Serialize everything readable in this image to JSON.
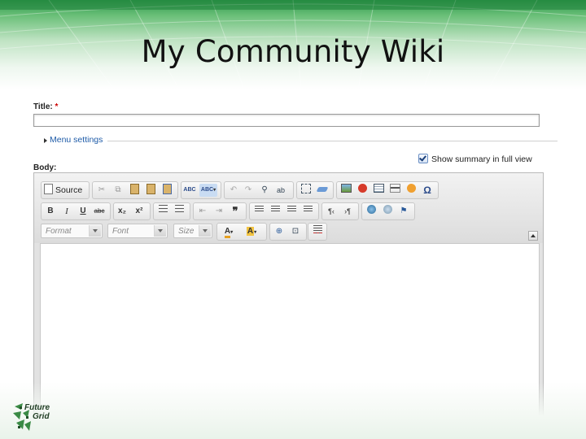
{
  "slide": {
    "title": "My Community Wiki"
  },
  "form": {
    "title_label": "Title:",
    "title_required": "*",
    "title_value": "",
    "menu_settings_label": "Menu settings",
    "show_summary_label": "Show summary in full view",
    "show_summary_checked": true,
    "body_label": "Body:"
  },
  "editor": {
    "source_label": "Source",
    "format_placeholder": "Format",
    "font_placeholder": "Font",
    "size_placeholder": "Size",
    "bold": "B",
    "italic": "I",
    "underline": "U",
    "strike": "abc",
    "subscript": "x₂",
    "superscript": "x²",
    "blockquote": "❞",
    "spell_abc": "ABC",
    "text_color": "A",
    "bg_color": "A",
    "body_content": ""
  },
  "logo": {
    "line1": "Future",
    "line2": "Grid"
  },
  "colors": {
    "link": "#1e5ba8",
    "required": "#cc0000",
    "banner_green": "#2e9a4b"
  }
}
